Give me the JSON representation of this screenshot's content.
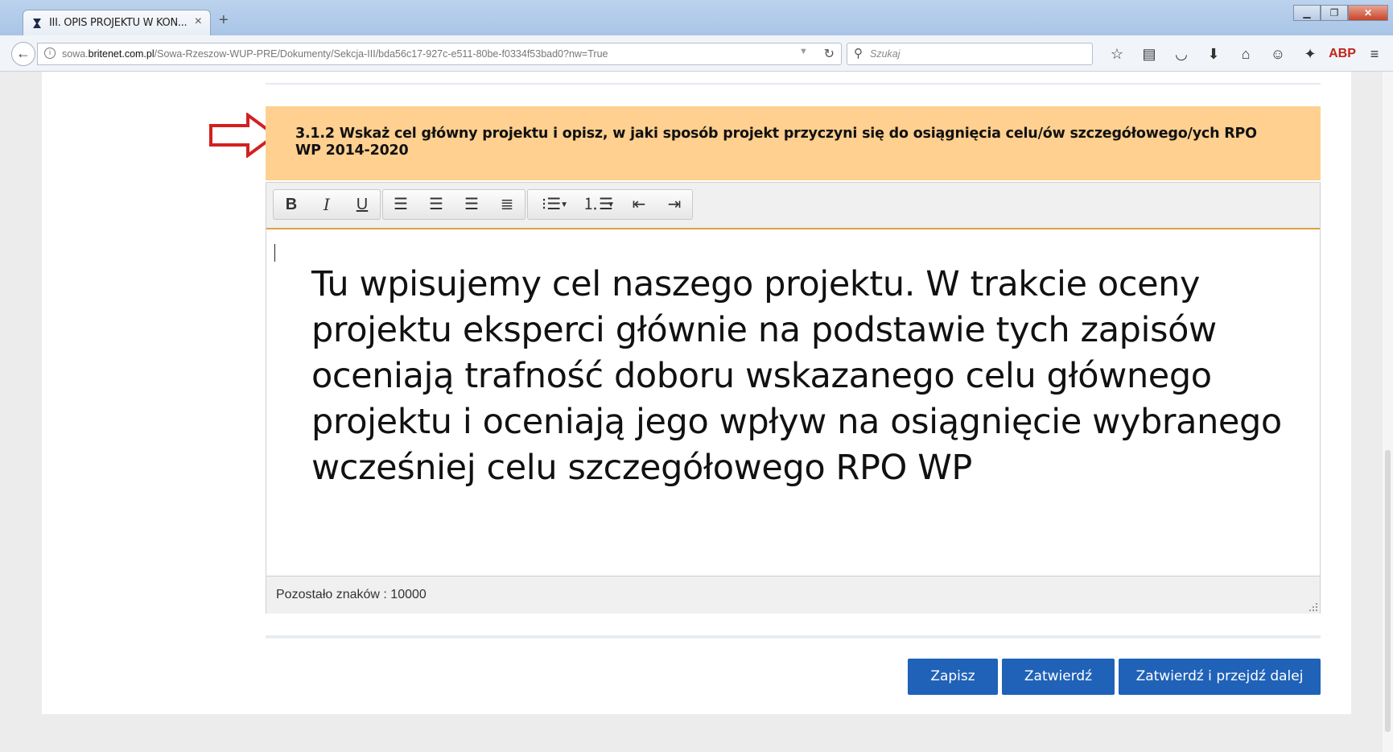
{
  "browser": {
    "tab_title": "III. OPIS PROJEKTU W KON...",
    "tab_close": "×",
    "new_tab": "+",
    "url_prefix": "sowa.",
    "url_domain": "britenet.com.pl",
    "url_path": "/Sowa-Rzeszow-WUP-PRE/Dokumenty/Sekcja-III/bda56c17-927c-e511-80be-f0334f53bad0?nw=True",
    "search_placeholder": "Szukaj",
    "toolbar_icons": [
      "star-icon",
      "reading-list-icon",
      "pocket-icon",
      "download-icon",
      "home-icon",
      "chat-icon",
      "addon-icon",
      "adblock-icon",
      "menu-icon"
    ],
    "adblock_label": "ABP"
  },
  "section": {
    "question_title": "3.1.2 Wskaż cel główny projektu i opisz, w jaki sposób projekt przyczyni się do osiągnięcia celu/ów szczegółowego/ych RPO WP 2014-2020"
  },
  "editor": {
    "body_text": "Tu wpisujemy cel naszego projektu. W trakcie oceny projektu eksperci głównie na podstawie tych zapisów oceniają trafność doboru wskazanego celu głównego projektu i oceniają jego wpływ na osiągnięcie wybranego wcześniej celu szczegółowego RPO WP",
    "chars_left": "Pozostało znaków : 10000",
    "toolbar": {
      "bold": "B",
      "italic": "I",
      "underline": "U"
    }
  },
  "actions": {
    "save": "Zapisz",
    "approve": "Zatwierdź",
    "approve_next": "Zatwierdź i przejdź dalej"
  },
  "colors": {
    "header_bg": "#ffd08f",
    "button_bg": "#1f62b8",
    "arrow": "#d32020",
    "toolbar_accent": "#e0a040"
  }
}
